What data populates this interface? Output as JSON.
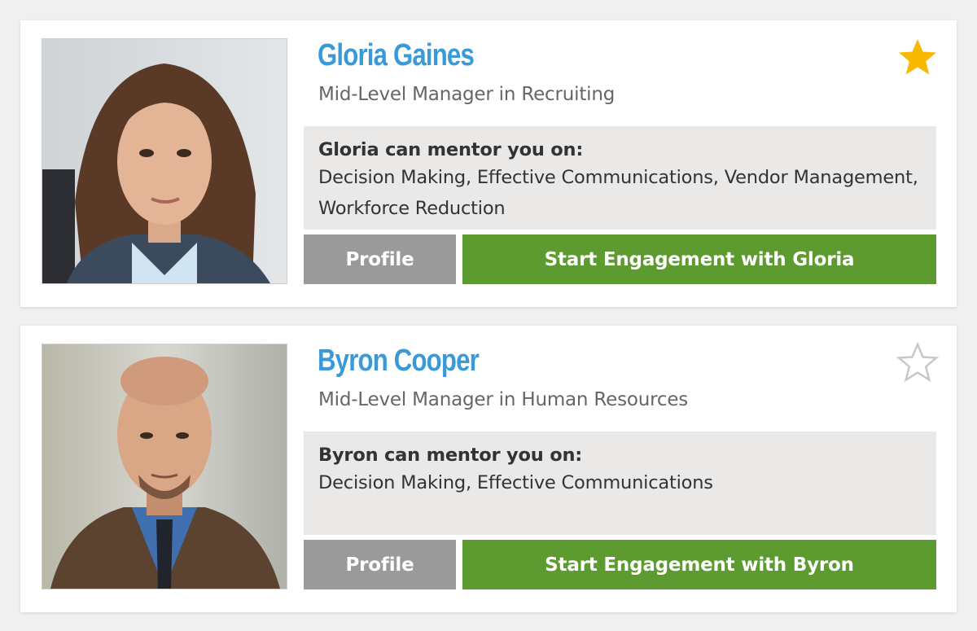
{
  "colors": {
    "name": "#3a9ad9",
    "profile_button": "#9a9a9a",
    "engage_button": "#5d9a2f",
    "star_filled": "#f8b800",
    "star_outline": "#c8c8c8",
    "mentor_box": "#eae9e8"
  },
  "mentors": [
    {
      "name": "Gloria Gaines",
      "role": "Mid-Level Manager in Recruiting",
      "favorite": true,
      "star_icon": "star-filled-icon",
      "mentor_title": "Gloria can mentor you on:",
      "mentor_topics": "Decision Making, Effective Communications, Vendor Management, Workforce Reduction",
      "profile_label": "Profile",
      "engage_label": "Start Engagement with Gloria"
    },
    {
      "name": "Byron Cooper",
      "role": "Mid-Level Manager in Human Resources",
      "favorite": false,
      "star_icon": "star-outline-icon",
      "mentor_title": "Byron can mentor you on:",
      "mentor_topics": "Decision Making, Effective Communications",
      "profile_label": "Profile",
      "engage_label": "Start Engagement with Byron"
    }
  ]
}
